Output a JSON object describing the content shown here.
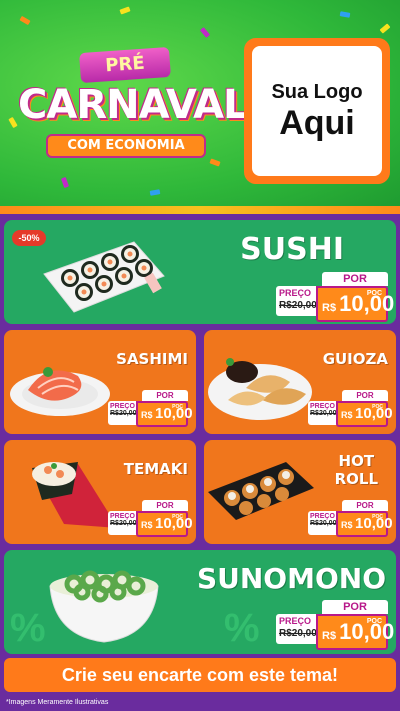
{
  "header": {
    "brand_pre": "PRÉ",
    "brand_main": "CARNAVAL",
    "brand_sub": "COM ECONOMIA",
    "logo_line1": "Sua Logo",
    "logo_line2": "Aqui"
  },
  "products": {
    "sushi": {
      "title": "SUSHI",
      "badge": "-50%",
      "por": "POR",
      "old_label": "PREÇO",
      "old_value": "R$20,00",
      "currency": "R$",
      "price": "10,00",
      "unit": "POC"
    },
    "sashimi": {
      "title": "SASHIMI",
      "por": "POR",
      "old_label": "PREÇO",
      "old_value": "R$20,00",
      "currency": "R$",
      "price": "10,00",
      "unit": "POC"
    },
    "guioza": {
      "title": "GUIOZA",
      "por": "POR",
      "old_label": "PREÇO",
      "old_value": "R$20,00",
      "currency": "R$",
      "price": "10,00",
      "unit": "POC"
    },
    "temaki": {
      "title": "TEMAKI",
      "por": "POR",
      "old_label": "PREÇO",
      "old_value": "R$20,00",
      "currency": "R$",
      "price": "10,00",
      "unit": "POC"
    },
    "hotroll": {
      "title_line1": "HOT",
      "title_line2": "ROLL",
      "por": "POR",
      "old_label": "PREÇO",
      "old_value": "R$20,00",
      "currency": "R$",
      "price": "10,00",
      "unit": "POC"
    },
    "sunomono": {
      "title": "SUNOMONO",
      "por": "POR",
      "old_label": "PREÇO",
      "old_value": "R$20,00",
      "currency": "R$",
      "price": "10,00",
      "unit": "POC"
    }
  },
  "cta": "Crie seu encarte com este tema!",
  "disclaimer": "*Imagens Meramente Ilustrativas",
  "colors": {
    "green": "#25a862",
    "orange": "#f0761c",
    "purple": "#6a2c9e",
    "magenta": "#b8188a"
  }
}
